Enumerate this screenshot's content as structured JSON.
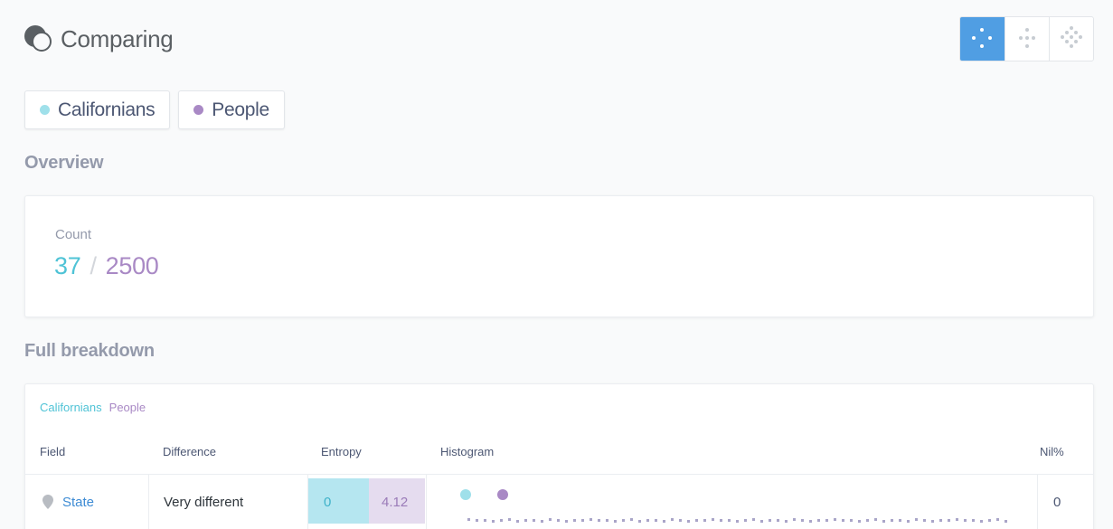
{
  "header": {
    "title": "Comparing",
    "icon": "compare-icon"
  },
  "view_toggle": {
    "options": [
      {
        "name": "view-option-1",
        "active": true
      },
      {
        "name": "view-option-2",
        "active": false
      },
      {
        "name": "view-option-3",
        "active": false
      }
    ],
    "active_color": "#509ee3"
  },
  "segments": [
    {
      "label": "Californians",
      "color": "#9fe0ea"
    },
    {
      "label": "People",
      "color": "#a989c5"
    }
  ],
  "overview": {
    "heading": "Overview",
    "count_label": "Count",
    "count_a": "37",
    "separator": "/",
    "count_b": "2500"
  },
  "breakdown": {
    "heading": "Full breakdown",
    "legend_a": "Californians",
    "legend_b": "People",
    "columns": {
      "field": "Field",
      "difference": "Difference",
      "entropy": "Entropy",
      "histogram": "Histogram",
      "nil": "Nil%"
    },
    "rows": [
      {
        "field": "State",
        "field_icon": "location-pin-icon",
        "difference": "Very different",
        "entropy_a": "0",
        "entropy_b": "4.12",
        "nil": "0"
      }
    ]
  },
  "colors": {
    "segment_a": "#4fc3d6",
    "segment_b": "#a989c5",
    "link": "#3d8bd4"
  }
}
